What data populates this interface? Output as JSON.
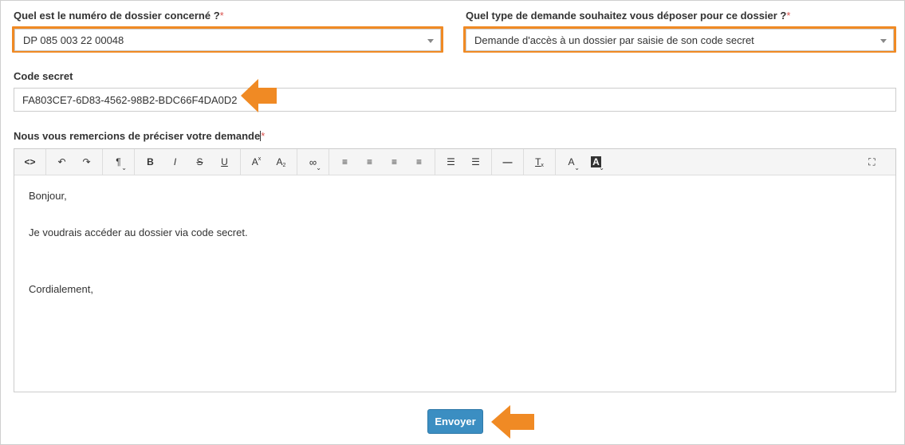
{
  "form": {
    "dossier_label": "Quel est le numéro de dossier concerné ?",
    "dossier_value": "DP 085 003 22 00048",
    "type_label": "Quel type de demande souhaitez vous déposer pour ce dossier ?",
    "type_value": "Demande d'accès à un dossier par saisie de son code secret",
    "required_mark": "*",
    "secret_label": "Code secret",
    "secret_value": "FA803CE7-6D83-4562-98B2-BDC66F4DA0D2",
    "demande_label": "Nous vous remercions de préciser votre demande",
    "submit_label": "Envoyer"
  },
  "editor": {
    "paragraphs": [
      "Bonjour,",
      "Je voudrais accéder au dossier via code secret.",
      "Cordialement,"
    ],
    "toolbar": {
      "code": "<>",
      "undo": "↶",
      "redo": "↷",
      "paragraph": "¶",
      "bold": "B",
      "italic": "I",
      "strike": "S",
      "underline": "U",
      "superscript": "A",
      "subscript": "A",
      "link": "🔗",
      "align_left": "≡",
      "align_center": "≡",
      "align_right": "≡",
      "justify": "≡",
      "bullets": "☰",
      "numbers": "☰",
      "hr": "—",
      "clear_format": "T",
      "font_color": "A",
      "bg_color": "A",
      "fullscreen": "⛶"
    }
  },
  "colors": {
    "highlight": "#f08a24",
    "button": "#3b8ec2",
    "required": "#d9534f"
  }
}
